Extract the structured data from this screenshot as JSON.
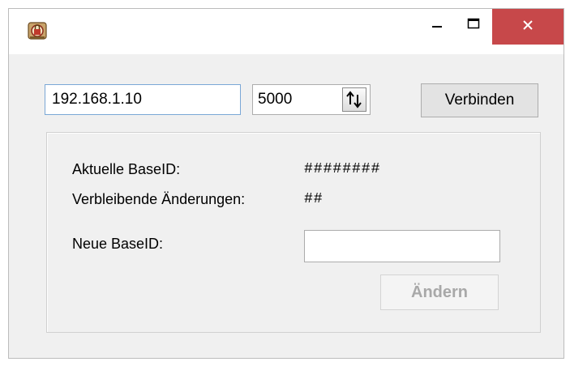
{
  "window": {
    "icon": "network-lock-icon",
    "controls": {
      "minimize": "minimize-icon",
      "maximize": "maximize-icon",
      "close": "close-icon"
    },
    "close_color": "#c7484a"
  },
  "connection": {
    "ip_value": "192.168.1.10",
    "port_value": "5000",
    "connect_label": "Verbinden"
  },
  "base_id": {
    "current_label": "Aktuelle BaseID:",
    "current_value": "########",
    "remaining_label": "Verbleibende Änderungen:",
    "remaining_value": "##",
    "new_label": "Neue BaseID:",
    "new_value": "",
    "change_label": "Ändern"
  }
}
